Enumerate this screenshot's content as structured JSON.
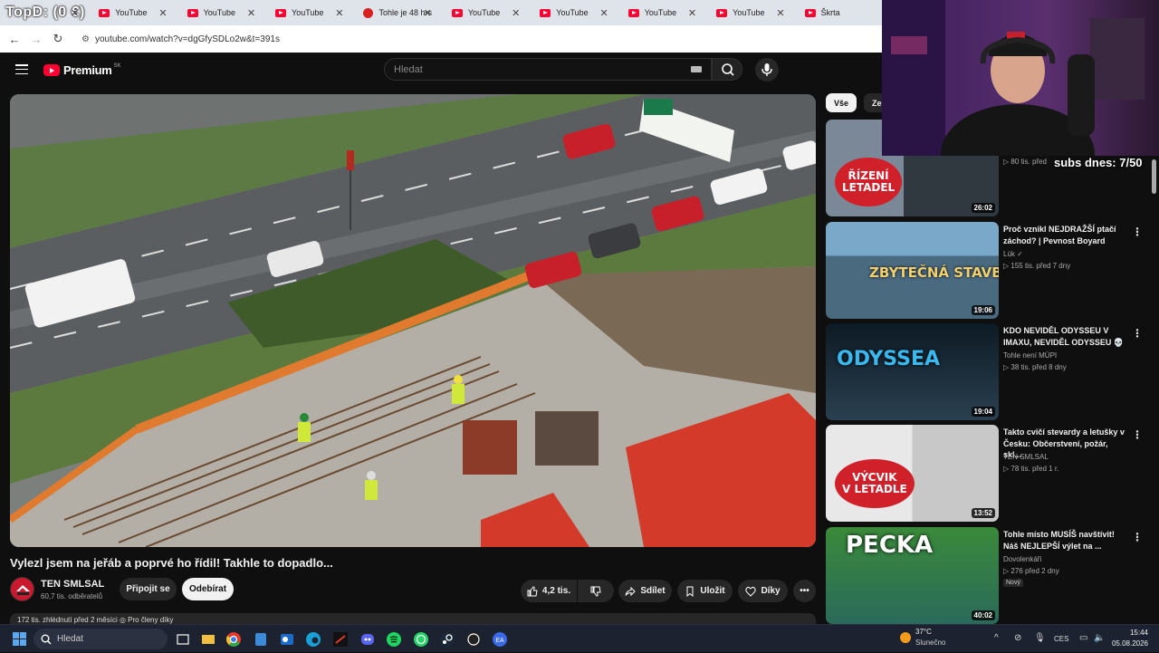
{
  "tabs": [
    {
      "title": "TopD: (0 €)",
      "type": "first"
    },
    {
      "title": "YouTube",
      "type": "yt"
    },
    {
      "title": "YouTube",
      "type": "yt"
    },
    {
      "title": "YouTube",
      "type": "yt"
    },
    {
      "title": "Tohle je 48 hrs",
      "type": "alt"
    },
    {
      "title": "YouTube",
      "type": "yt"
    },
    {
      "title": "YouTube",
      "type": "yt"
    },
    {
      "title": "YouTube",
      "type": "yt"
    },
    {
      "title": "YouTube",
      "type": "yt"
    },
    {
      "title": "Škrta",
      "type": "yt"
    }
  ],
  "address": {
    "url": "youtube.com/watch?v=dgGfySDLo2w&t=391s"
  },
  "header": {
    "logo_text": "Premium",
    "country_code": "SK",
    "search_placeholder": "Hledat"
  },
  "video": {
    "title": "Vylezl jsem na jeřáb a poprvé ho řídil! Takhle to dopadlo...",
    "channel": "TEN SMLSAL",
    "subscribers": "60,7 tis. odběratelů",
    "join_label": "Připojit se",
    "subscribe_label": "Odebírat",
    "likes": "4,2 tis.",
    "share_label": "Sdílet",
    "save_label": "Uložit",
    "thanks_label": "Díky",
    "description_snippet": "172 tis. zhlédnutí  před 2 měsíci  ◎ Pro členy díky"
  },
  "chips": [
    {
      "label": "Vše",
      "active": true
    },
    {
      "label": "Ze s",
      "active": false
    }
  ],
  "recommendations": [
    {
      "title": "",
      "channel": "",
      "meta": "▷ 80 tis.   před",
      "duration": "26:02",
      "thumb_text": "ŘÍZENÍ\nLETADEL",
      "new": false
    },
    {
      "title": "Proč vznikl NEJDRAŽŠÍ ptačí záchod? | Pevnost Boyard",
      "channel": "Lúk ✓",
      "meta": "▷ 155 tis.   před 7 dny",
      "duration": "19:06",
      "thumb_text": "ZBYTEČNÁ STAVBA",
      "new": false
    },
    {
      "title": "KDO NEVIDĚL ODYSSEU V IMAXU, NEVIDĚL ODYSSEU 💀",
      "channel": "Tohle není MÚPI",
      "meta": "▷ 38 tis.   před 8 dny",
      "duration": "19:04",
      "thumb_text": "ODYSSEA",
      "new": false
    },
    {
      "title": "Takto cvičí stevardy a letušky v Česku: Občerstvení, požár, skl...",
      "channel": "TEN SMLSAL",
      "meta": "▷ 78 tis.   před 1 r.",
      "duration": "13:52",
      "thumb_text": "VÝCVIK\nV LETADLE",
      "new": false
    },
    {
      "title": "Tohle místo MUSÍŠ navštívit! Náš NEJLEPŠÍ výlet na ...",
      "channel": "Dovolenkáři",
      "meta": "▷ 276   před 2 dny",
      "duration": "40:02",
      "thumb_text": "PECKA",
      "new": true,
      "new_label": "Nový"
    }
  ],
  "overlay": {
    "subs_today": "subs dnes: 7/50"
  },
  "taskbar": {
    "search_placeholder": "Hledat",
    "temperature": "37°C",
    "condition": "Slunečno",
    "language": "CES",
    "time": "15:44",
    "date": "05.08.2026"
  }
}
